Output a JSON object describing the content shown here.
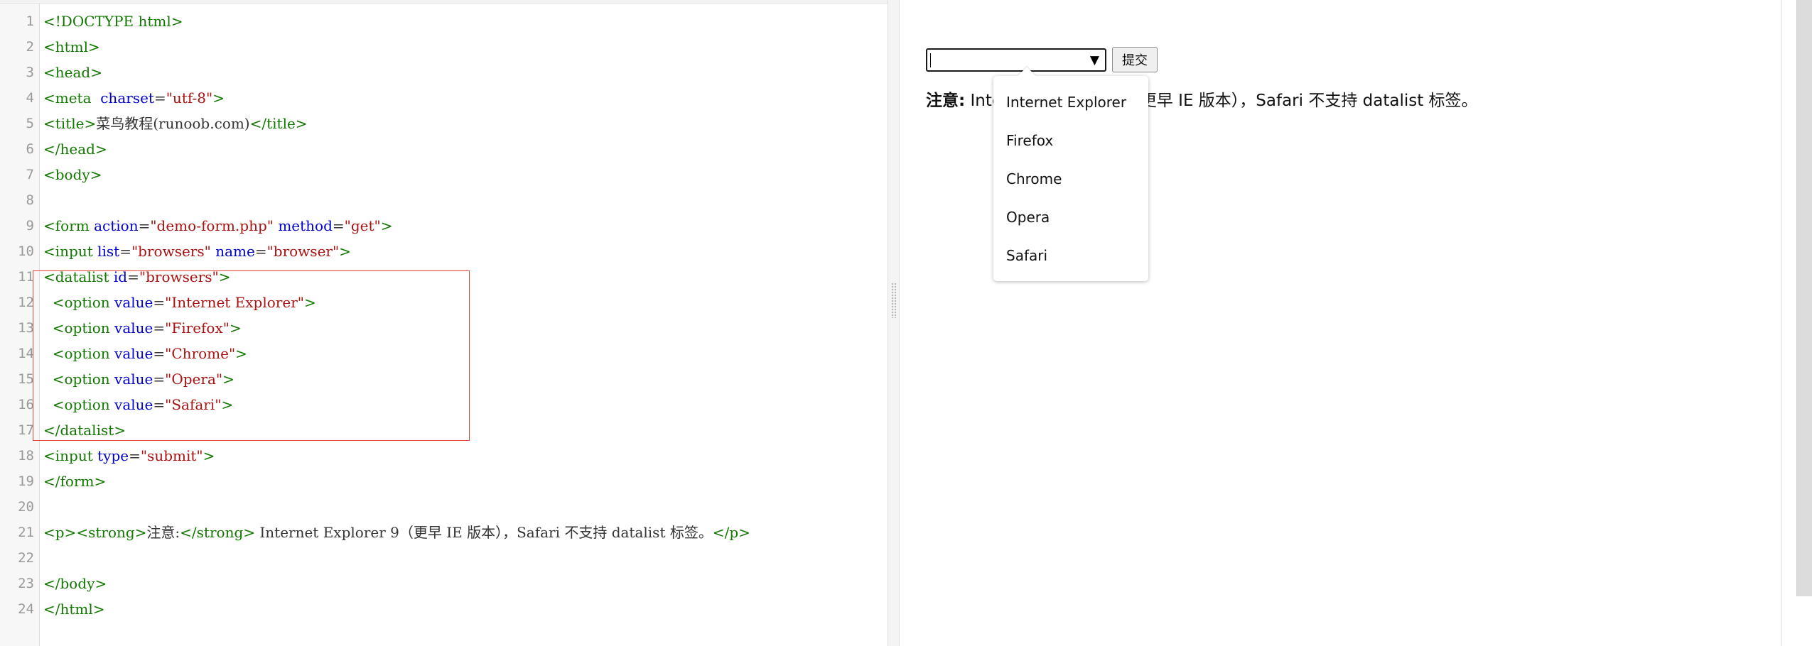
{
  "editor": {
    "lines": [
      {
        "no": "1",
        "tokens": [
          {
            "t": "tag",
            "v": "<!DOCTYPE html>"
          }
        ]
      },
      {
        "no": "2",
        "tokens": [
          {
            "t": "tag",
            "v": "<html>"
          }
        ]
      },
      {
        "no": "3",
        "tokens": [
          {
            "t": "tag",
            "v": "<head>"
          }
        ]
      },
      {
        "no": "4",
        "tokens": [
          {
            "t": "tag",
            "v": "<meta  "
          },
          {
            "t": "attr",
            "v": "charset"
          },
          {
            "t": "plain",
            "v": "="
          },
          {
            "t": "str",
            "v": "\"utf-8\""
          },
          {
            "t": "tag",
            "v": ">"
          }
        ]
      },
      {
        "no": "5",
        "tokens": [
          {
            "t": "tag",
            "v": "<title>"
          },
          {
            "t": "plain",
            "v": "菜鸟教程(runoob.com)"
          },
          {
            "t": "tag",
            "v": "</title>"
          }
        ]
      },
      {
        "no": "6",
        "tokens": [
          {
            "t": "tag",
            "v": "</head>"
          }
        ]
      },
      {
        "no": "7",
        "tokens": [
          {
            "t": "tag",
            "v": "<body>"
          }
        ]
      },
      {
        "no": "8",
        "tokens": []
      },
      {
        "no": "9",
        "tokens": [
          {
            "t": "tag",
            "v": "<form "
          },
          {
            "t": "attr",
            "v": "action"
          },
          {
            "t": "plain",
            "v": "="
          },
          {
            "t": "str",
            "v": "\"demo-form.php\""
          },
          {
            "t": "plain",
            "v": " "
          },
          {
            "t": "attr",
            "v": "method"
          },
          {
            "t": "plain",
            "v": "="
          },
          {
            "t": "str",
            "v": "\"get\""
          },
          {
            "t": "tag",
            "v": ">"
          }
        ]
      },
      {
        "no": "10",
        "tokens": [
          {
            "t": "tag",
            "v": "<input "
          },
          {
            "t": "attr",
            "v": "list"
          },
          {
            "t": "plain",
            "v": "="
          },
          {
            "t": "str",
            "v": "\"browsers\""
          },
          {
            "t": "plain",
            "v": " "
          },
          {
            "t": "attr",
            "v": "name"
          },
          {
            "t": "plain",
            "v": "="
          },
          {
            "t": "str",
            "v": "\"browser\""
          },
          {
            "t": "tag",
            "v": ">"
          }
        ]
      },
      {
        "no": "11",
        "tokens": [
          {
            "t": "tag",
            "v": "<datalist "
          },
          {
            "t": "attr",
            "v": "id"
          },
          {
            "t": "plain",
            "v": "="
          },
          {
            "t": "str",
            "v": "\"browsers\""
          },
          {
            "t": "tag",
            "v": ">"
          }
        ]
      },
      {
        "no": "12",
        "tokens": [
          {
            "t": "plain",
            "v": "  "
          },
          {
            "t": "tag",
            "v": "<option "
          },
          {
            "t": "attr",
            "v": "value"
          },
          {
            "t": "plain",
            "v": "="
          },
          {
            "t": "str",
            "v": "\"Internet Explorer\""
          },
          {
            "t": "tag",
            "v": ">"
          }
        ]
      },
      {
        "no": "13",
        "tokens": [
          {
            "t": "plain",
            "v": "  "
          },
          {
            "t": "tag",
            "v": "<option "
          },
          {
            "t": "attr",
            "v": "value"
          },
          {
            "t": "plain",
            "v": "="
          },
          {
            "t": "str",
            "v": "\"Firefox\""
          },
          {
            "t": "tag",
            "v": ">"
          }
        ]
      },
      {
        "no": "14",
        "tokens": [
          {
            "t": "plain",
            "v": "  "
          },
          {
            "t": "tag",
            "v": "<option "
          },
          {
            "t": "attr",
            "v": "value"
          },
          {
            "t": "plain",
            "v": "="
          },
          {
            "t": "str",
            "v": "\"Chrome\""
          },
          {
            "t": "tag",
            "v": ">"
          }
        ]
      },
      {
        "no": "15",
        "tokens": [
          {
            "t": "plain",
            "v": "  "
          },
          {
            "t": "tag",
            "v": "<option "
          },
          {
            "t": "attr",
            "v": "value"
          },
          {
            "t": "plain",
            "v": "="
          },
          {
            "t": "str",
            "v": "\"Opera\""
          },
          {
            "t": "tag",
            "v": ">"
          }
        ]
      },
      {
        "no": "16",
        "tokens": [
          {
            "t": "plain",
            "v": "  "
          },
          {
            "t": "tag",
            "v": "<option "
          },
          {
            "t": "attr",
            "v": "value"
          },
          {
            "t": "plain",
            "v": "="
          },
          {
            "t": "str",
            "v": "\"Safari\""
          },
          {
            "t": "tag",
            "v": ">"
          }
        ]
      },
      {
        "no": "17",
        "tokens": [
          {
            "t": "tag",
            "v": "</datalist>"
          }
        ]
      },
      {
        "no": "18",
        "tokens": [
          {
            "t": "tag",
            "v": "<input "
          },
          {
            "t": "attr",
            "v": "type"
          },
          {
            "t": "plain",
            "v": "="
          },
          {
            "t": "str",
            "v": "\"submit\""
          },
          {
            "t": "tag",
            "v": ">"
          }
        ]
      },
      {
        "no": "19",
        "tokens": [
          {
            "t": "tag",
            "v": "</form>"
          }
        ]
      },
      {
        "no": "20",
        "tokens": []
      },
      {
        "no": "21",
        "tokens": [
          {
            "t": "tag",
            "v": "<p><strong>"
          },
          {
            "t": "plain",
            "v": "注意:"
          },
          {
            "t": "tag",
            "v": "</strong>"
          },
          {
            "t": "plain",
            "v": " Internet Explorer 9（更早 IE 版本），Safari 不支持 datalist 标签。"
          },
          {
            "t": "tag",
            "v": "</p>"
          }
        ]
      },
      {
        "no": "22",
        "tokens": []
      },
      {
        "no": "23",
        "tokens": [
          {
            "t": "tag",
            "v": "</body>"
          }
        ]
      },
      {
        "no": "24",
        "tokens": [
          {
            "t": "tag",
            "v": "</html>"
          }
        ]
      }
    ]
  },
  "preview": {
    "input_value": "",
    "dropdown_arrow_glyph": "▼",
    "submit_label": "提交",
    "note_strong": "注意:",
    "note_text": " Internet Explorer 9（更早 IE 版本），Safari 不支持 datalist 标签。",
    "datalist_options": [
      "Internet Explorer",
      "Firefox",
      "Chrome",
      "Opera",
      "Safari"
    ]
  },
  "colors": {
    "tag": "#117700",
    "attr": "#0000cc",
    "string": "#aa1111",
    "plain": "#333333",
    "highlight_box": "#e0443b"
  }
}
